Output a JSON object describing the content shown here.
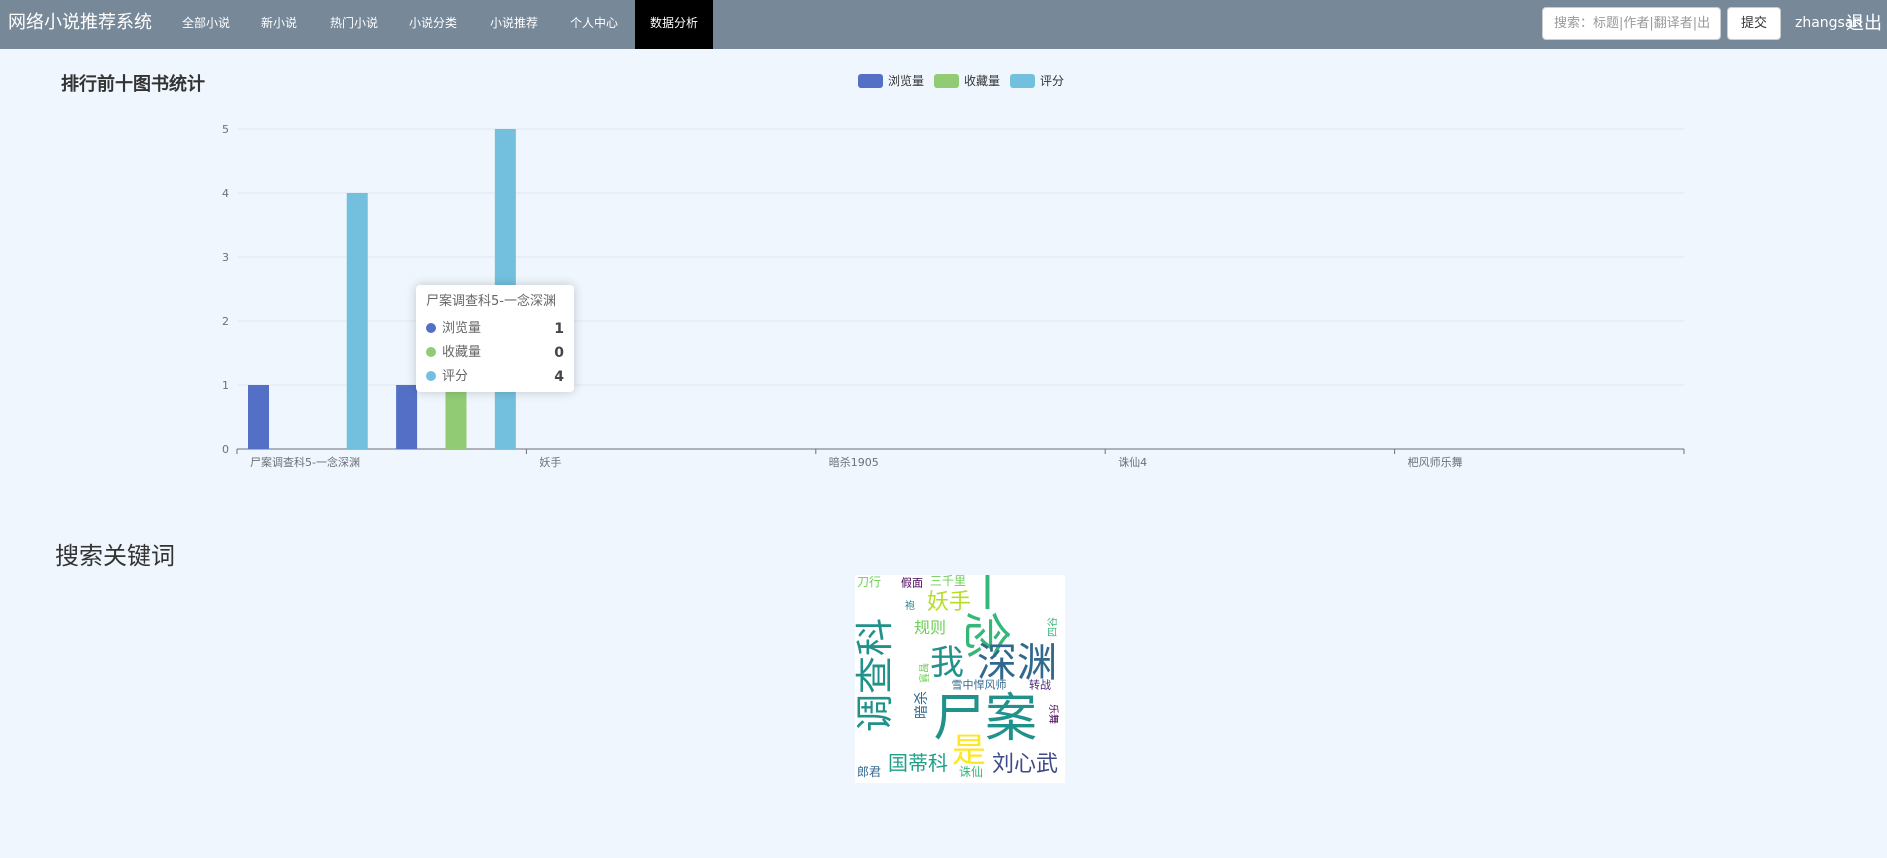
{
  "navbar": {
    "brand": "网络小说推荐系统",
    "items": [
      "全部小说",
      "新小说",
      "热门小说",
      "小说分类",
      "小说推荐",
      "个人中心",
      "数据分析"
    ],
    "active_index": 6,
    "search_placeholder": "搜索：标题|作者|翻译者|出",
    "submit_label": "提交",
    "user": "zhangsan",
    "logout_label": "退出",
    "bg_color": "#778899"
  },
  "chart_title": "排行前十图书统计",
  "chart_data": {
    "type": "bar",
    "categories": [
      "尸案调查科5-一念深渊",
      "妖手",
      "暗杀1905",
      "诛仙4",
      "杷风师乐舞"
    ],
    "series": [
      {
        "name": "浏览量",
        "color": "#5470c6",
        "values": [
          1,
          0,
          0,
          0,
          0
        ]
      },
      {
        "name": "收藏量",
        "color": "#91cc75",
        "values": [
          0,
          0,
          0,
          0,
          0
        ]
      },
      {
        "name": "评分",
        "color": "#73c0de",
        "values": [
          4,
          0,
          0,
          0,
          0
        ]
      }
    ],
    "extra_bars": [
      {
        "series": "浏览量",
        "value": 1
      },
      {
        "series": "收藏量",
        "value": 1
      },
      {
        "series": "评分",
        "value": 5
      }
    ],
    "ylim": [
      0,
      5
    ],
    "yticks": [
      "0",
      "1",
      "2",
      "3",
      "4",
      "5"
    ],
    "legend_position": "top-center",
    "grid": true
  },
  "tooltip": {
    "title": "尸案调查科5-一念深渊",
    "rows": [
      {
        "label": "浏览量",
        "value": "1",
        "color": "#5470c6"
      },
      {
        "label": "收藏量",
        "value": "0",
        "color": "#91cc75"
      },
      {
        "label": "评分",
        "value": "4",
        "color": "#73c0de"
      }
    ]
  },
  "keywords_title": "搜索关键词",
  "wordcloud": {
    "words": [
      {
        "text": "调查科",
        "color": "#21918c"
      },
      {
        "text": "一念",
        "color": "#35b779"
      },
      {
        "text": "尸案",
        "color": "#21918c"
      },
      {
        "text": "深渊",
        "color": "#31688e"
      },
      {
        "text": "我",
        "color": "#21918c"
      },
      {
        "text": "妖手",
        "color": "#b5de2b"
      },
      {
        "text": "是",
        "color": "#fde725"
      },
      {
        "text": "刘心武",
        "color": "#3e4989"
      },
      {
        "text": "国蒂科",
        "color": "#1f9e89"
      },
      {
        "text": "规则",
        "color": "#6ece58"
      },
      {
        "text": "刀行",
        "color": "#6ece58"
      },
      {
        "text": "假面",
        "color": "#440154"
      },
      {
        "text": "三千里",
        "color": "#6ece58"
      },
      {
        "text": "雪中悍风师",
        "color": "#31688e"
      },
      {
        "text": "转战",
        "color": "#482878"
      },
      {
        "text": "暗杀",
        "color": "#31688e"
      },
      {
        "text": "诛仙",
        "color": "#35b779"
      },
      {
        "text": "郎君",
        "color": "#31688e"
      },
      {
        "text": "智慧",
        "color": "#6ece58"
      },
      {
        "text": "乐舞",
        "color": "#440154"
      },
      {
        "text": "袍",
        "color": "#26828e"
      },
      {
        "text": "四谷",
        "color": "#35b779"
      }
    ]
  }
}
